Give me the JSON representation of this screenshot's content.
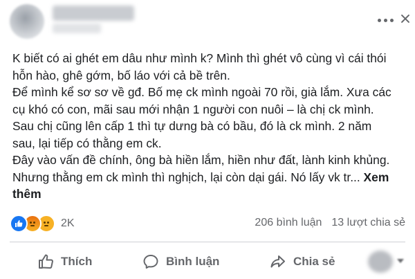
{
  "post": {
    "text_lines": [
      "K biết có ai ghét em dâu như mình k? Mình thì ghét vô cùng vì cái thói",
      "hỗn hào, ghê gớm, bố láo với cả bề trên.",
      "Để mình kể sơ sơ về gđ. Bố mẹ ck mình ngoài 70 rồi, già lắm. Xưa các",
      "cụ khó có con, mãi sau mới nhận 1 người con nuôi – là chị ck mình.",
      "Sau chị cũng lên cấp 1 thì tự dưng bà có bầu, đó là ck mình. 2 năm",
      "sau, lại tiếp có thằng em ck.",
      "Đây vào vấn đề chính, ông bà hiền lắm, hiền như đất, lành kinh khủng.",
      "Nhưng thằng em ck mình thì nghịch, lại còn dại gái. Nó lấy vk tr..."
    ],
    "see_more_part1": "Xem",
    "see_more_part2": "thêm"
  },
  "engagement": {
    "reaction_count": "2K",
    "comments": "206 bình luận",
    "shares": "13 lượt chia sẻ",
    "reaction_icons": [
      "like-icon",
      "angry-icon",
      "sad-icon"
    ],
    "colors": {
      "like": "#1877f2",
      "angry": "#e9710f",
      "sad": "#f7b125",
      "muted_text": "#65676b"
    }
  },
  "actions": {
    "like": "Thích",
    "comment": "Bình luận",
    "share": "Chia sẻ"
  }
}
